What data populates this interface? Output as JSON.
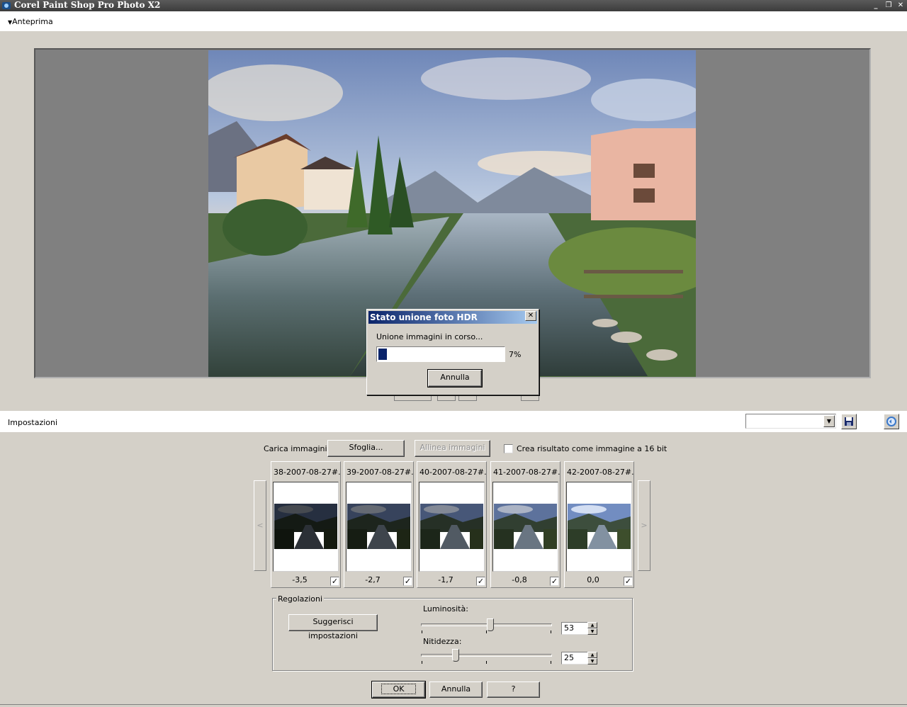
{
  "window": {
    "title": "Corel Paint Shop Pro Photo X2",
    "min_glyph": "_",
    "restore_glyph": "❐",
    "close_glyph": "✕"
  },
  "preview": {
    "toggle_label": "Anteprima"
  },
  "settings": {
    "label": "Impostazioni",
    "preset_value": ""
  },
  "load": {
    "label": "Carica immagini:",
    "browse_label": "Sfoglia...",
    "align_label": "Allinea immagini",
    "create16_label": "Crea risultato come immagine a 16 bit",
    "create16_checked_mark": ""
  },
  "thumbnails": [
    {
      "name": "38-2007-08-27#...",
      "ev": "-3,5",
      "checked_mark": "✓",
      "brightness": 0.35
    },
    {
      "name": "39-2007-08-27#...",
      "ev": "-2,7",
      "checked_mark": "✓",
      "brightness": 0.5
    },
    {
      "name": "40-2007-08-27#...",
      "ev": "-1,7",
      "checked_mark": "✓",
      "brightness": 0.65
    },
    {
      "name": "41-2007-08-27#...",
      "ev": "-0,8",
      "checked_mark": "✓",
      "brightness": 0.85
    },
    {
      "name": "42-2007-08-27#...",
      "ev": "0,0",
      "checked_mark": "✓",
      "brightness": 1.05
    }
  ],
  "nav": {
    "prev": "<",
    "next": ">"
  },
  "adjustments": {
    "group_title": "Regolazioni",
    "suggest_label": "Suggerisci impostazioni",
    "brightness_label": "Luminosità:",
    "brightness_value": "53",
    "brightness_fraction": 0.53,
    "sharpness_label": "Nitidezza:",
    "sharpness_value": "25",
    "sharpness_fraction": 0.25
  },
  "buttons": {
    "ok": "OK",
    "cancel": "Annulla",
    "help": "?"
  },
  "dialog": {
    "title": "Stato unione foto HDR",
    "message": "Unione immagini in corso...",
    "percent_label": "7%",
    "progress_fraction": 0.07,
    "cancel_label": "Annulla",
    "close_glyph": "✕"
  }
}
